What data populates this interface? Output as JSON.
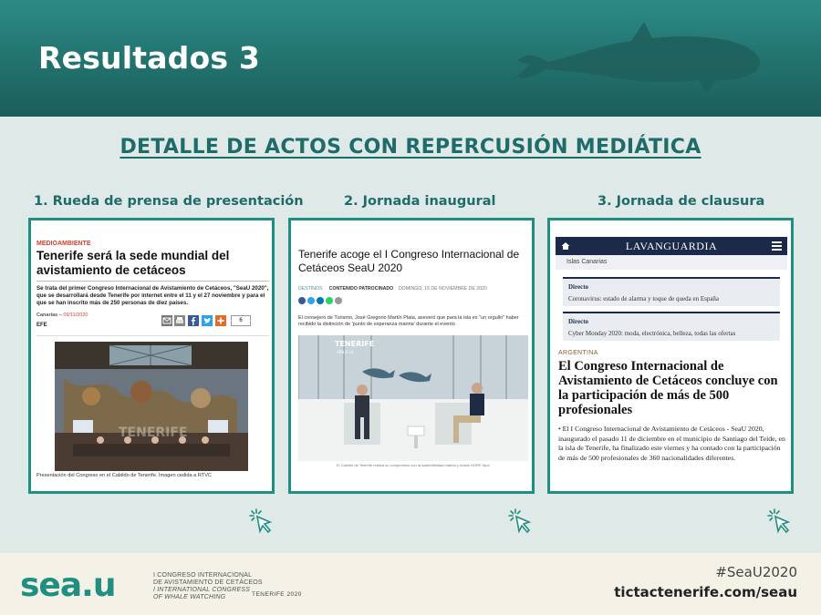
{
  "header": {
    "title": "Resultados 3"
  },
  "subtitle": "DETALLE DE ACTOS CON REPERCUSIÓN MEDIÁTICA",
  "columns": [
    {
      "title": "1. Rueda de prensa de presentación"
    },
    {
      "title": "2. Jornada inaugural"
    },
    {
      "title": "3. Jornada de clausura"
    }
  ],
  "card1": {
    "section": "MEDIOAMBIENTE",
    "headline": "Tenerife será la sede mundial del avistamiento de cetáceos",
    "body": "Se trata del primer Congreso Internacional de Avistamiento de Cetáceos, \"SeaU 2020\", que se desarrollará desde Tenerife por internet entre el 11 y el 27 noviembre y para el que se han inscrito más de 250 personas de diez países.",
    "meta_place": "Canarias – ",
    "meta_date": "09/11/2020",
    "source": "EFE",
    "share_count": "6",
    "photo_watermark": "TENERIFE",
    "caption": "Presentación del Congreso en el Cabildo de Tenerife. Imagen cedida a RTVC"
  },
  "card2": {
    "headline": "Tenerife acoge el I Congreso Internacional de Cetáceos SeaU 2020",
    "tag1": "DESTINOS",
    "tag2": "CONTENIDO PATROCINADO",
    "date": "DOMINGO, 15 DE NOVIEMBRE DE 2020",
    "body": "El consejero de Turismo, José Gregorio Martín Plata, aseveró que para la isla es \"un orgullo\" haber recibido la distinción de 'punto de esperanza marina' durante el evento",
    "photo_sign": "TENERIFE",
    "photo_sign_sub": "VEN A LA",
    "caption": "El Cabildo de Tenerife realiza su compromiso con la sostenibilidad marina y recibe HOPE Spot"
  },
  "card3": {
    "brand": "LAVANGUARDIA",
    "location": "Islas Canarias",
    "live": [
      {
        "label": "Directo",
        "text": "Coronavirus: estado de alarma y toque de queda en España"
      },
      {
        "label": "Directo",
        "text": "Cyber Monday 2020: moda, electrónica, belleza, todas las ofertas"
      }
    ],
    "country": "ARGENTINA",
    "headline": "El Congreso Internacional de Avistamiento de Cetáceos concluye con la participación de más de 500 profesionales",
    "body": "• El I Congreso Internacional de Avistamiento de Cetáceos - SeaU 2020, inaugurado el pasado 11 de diciembre en el municipio de Santiago del Teide, en la isla de Tenerife, ha finalizado este viernes y ha contado con la participación de más de 500 profesionales de 360 nacionalidades diferentes."
  },
  "footer": {
    "logo": "sea.u",
    "line1": "I CONGRESO INTERNACIONAL",
    "line2": "DE AVISTAMIENTO DE CETÁCEOS",
    "line3": "I INTERNATIONAL CONGRESS",
    "line4": "OF WHALE WATCHING",
    "edition": "TENERIFE 2020",
    "hashtag": "#SeaU2020",
    "url": "tictactenerife.com/seau"
  },
  "colors": {
    "teal_dark": "#1e6c6a",
    "card_border": "#1e8f80",
    "header_bg": "#22716d",
    "page_bg": "#dfe9e7",
    "footer_bg": "#f4f1e6"
  },
  "icons": [
    "whale-icon",
    "click-cursor-icon",
    "home-icon",
    "menu-icon",
    "email-icon",
    "print-icon",
    "facebook-icon",
    "twitter-icon",
    "plus-icon"
  ]
}
